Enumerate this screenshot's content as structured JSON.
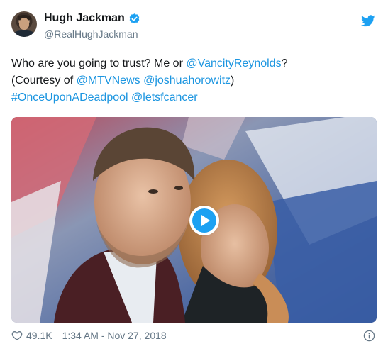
{
  "author": {
    "display_name": "Hugh Jackman",
    "handle": "@RealHughJackman",
    "verified": true,
    "avatar_icon": "profile-photo"
  },
  "tweet": {
    "line1_prefix": "Who are you going to trust? Me or ",
    "line1_mention": "@VancityReynolds",
    "line1_suffix": "?",
    "line2_prefix": "(Courtesy of ",
    "line2_mention1": "@MTVNews",
    "line2_space": " ",
    "line2_mention2": "@joshuahorowitz",
    "line2_suffix": ")",
    "line3_hashtag": "#OnceUponADeadpool",
    "line3_space": " ",
    "line3_mention": "@letsfcancer"
  },
  "media": {
    "type": "video",
    "play_icon": "play-icon"
  },
  "footer": {
    "like_icon": "heart-icon",
    "like_count": "49.1K",
    "timestamp": "1:34 AM - Nov 27, 2018",
    "info_icon": "info-icon"
  },
  "colors": {
    "link": "#1b95e0",
    "brand": "#1da1f2",
    "secondary_text": "#657786"
  }
}
